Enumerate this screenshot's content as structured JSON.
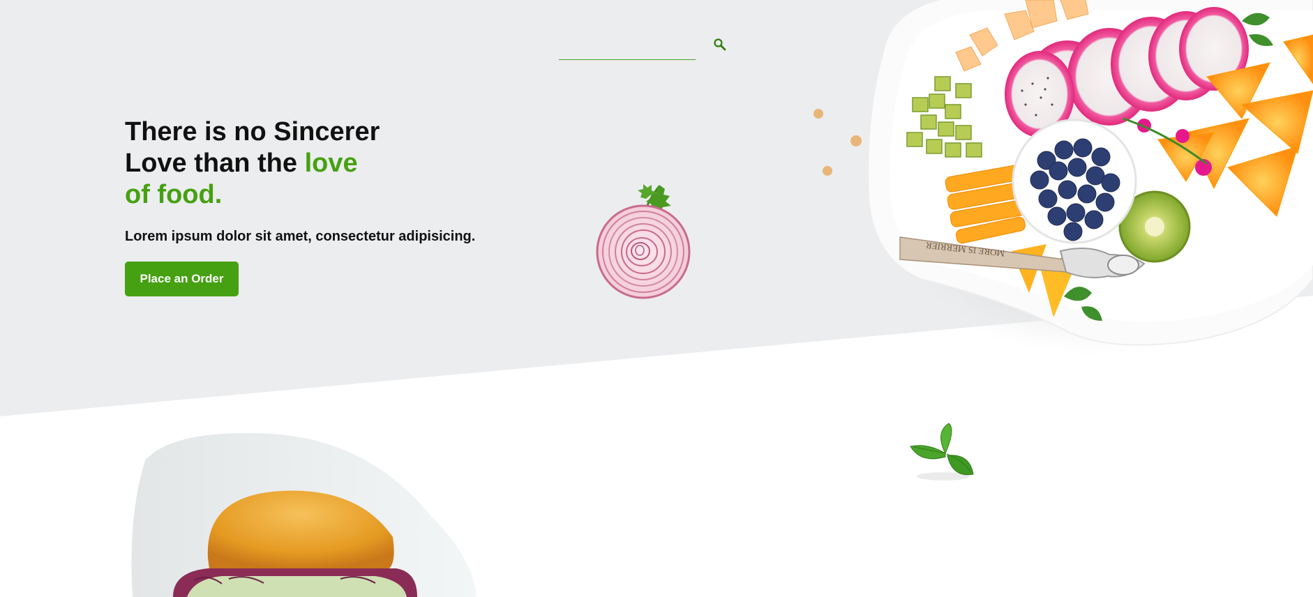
{
  "search": {
    "placeholder": "",
    "value": "",
    "icon": "search-icon"
  },
  "hero": {
    "title_line1": "There is no Sincerer",
    "title_line2": "Love than the ",
    "title_accent1": "love",
    "title_accent2": "of food.",
    "subtitle": "Lorem ipsum dolor sit amet, consectetur adipisicing.",
    "cta_label": "Place an Order"
  },
  "images": {
    "fruit_platter": "fruit-platter-image",
    "spoon_engraving": "MORE IS MERRIER",
    "onion": "onion-slice-image",
    "basil": "basil-leaf-image",
    "burger": "burger-image"
  },
  "colors": {
    "accent": "#45a111",
    "hero_background": "#ecedef",
    "text": "#111111",
    "page_background": "#ffffff"
  }
}
